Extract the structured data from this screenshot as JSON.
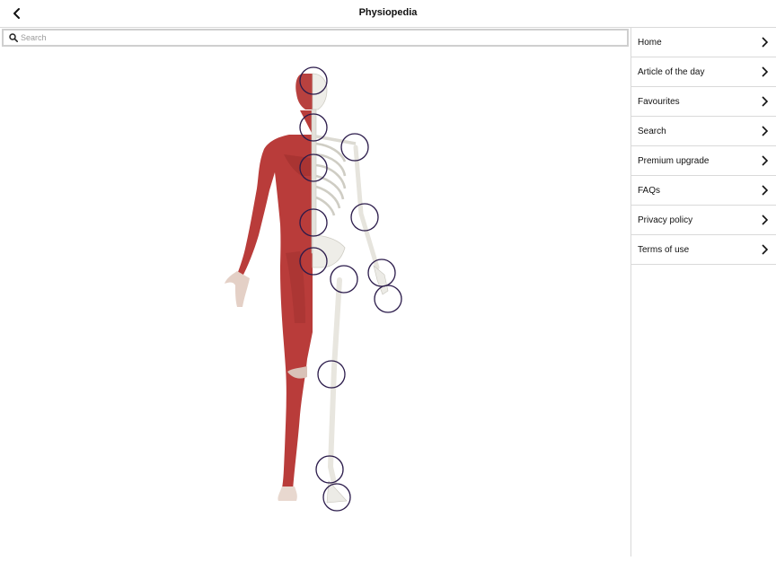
{
  "header": {
    "title": "Physiopedia",
    "back_icon": "chevron-left-icon"
  },
  "search": {
    "placeholder": "Search",
    "value": "",
    "icon": "search-icon"
  },
  "sidebar": {
    "items": [
      {
        "label": "Home"
      },
      {
        "label": "Article of the day"
      },
      {
        "label": "Favourites"
      },
      {
        "label": "Search"
      },
      {
        "label": "Premium upgrade"
      },
      {
        "label": "FAQs"
      },
      {
        "label": "Privacy policy"
      },
      {
        "label": "Terms of use"
      }
    ]
  },
  "body_map": {
    "description_icon": "human-anatomy-figure",
    "hotspots": [
      "head",
      "neck",
      "shoulder",
      "thoracic-spine",
      "elbow",
      "lumbar-spine",
      "pelvis",
      "hip",
      "wrist",
      "hand",
      "knee",
      "ankle",
      "foot"
    ],
    "colors": {
      "muscle": "#b83a3a",
      "bone": "#ecebe6",
      "hotspot_ring": "#2a1a4a"
    }
  }
}
